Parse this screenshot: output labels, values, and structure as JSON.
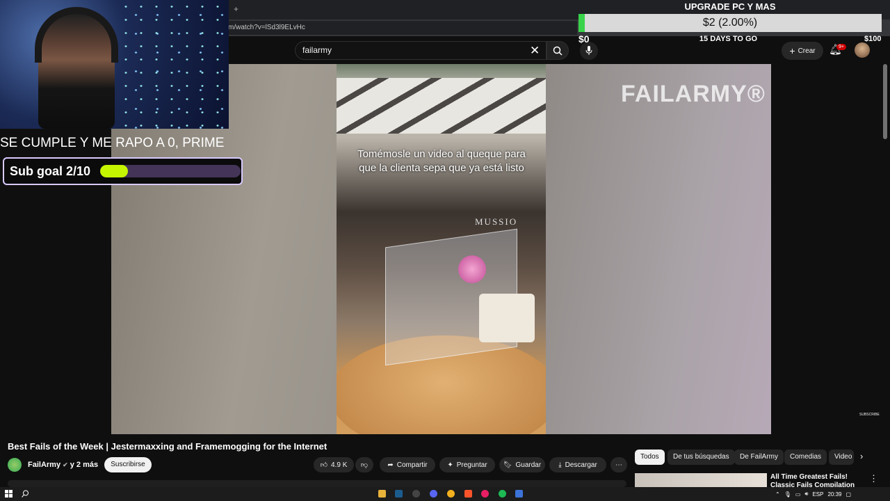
{
  "browser": {
    "tab_plus": "+",
    "address": "m/watch?v=lSd3l9ELvHc"
  },
  "youtube_header": {
    "search_value": "failarmy",
    "create_label": "Crear",
    "notifications_badge": "9+"
  },
  "overlay": {
    "marquee_text": "SE CUMPLE Y ME RAPO A 0, PRIME",
    "sub_goal_label": "Sub goal 2/10",
    "sub_goal_fraction": 0.2
  },
  "donation_goal": {
    "title": "UPGRADE PC Y MAS",
    "amount": "$2 (2.00%)",
    "progress_percent": 2.0,
    "min": "$0",
    "max": "$100",
    "days_left": "15 DAYS TO GO"
  },
  "video": {
    "caption": "Tomémosle un video al queque para que la clienta sepa que ya está listo",
    "watermark_brand": "FAILARMY®",
    "sign_text": "MUSSIO",
    "subscribe_watermark": "SUBSCRIBE"
  },
  "video_info": {
    "title": "Best Fails of the Week | Jestermaxxing and Framemogging for the Internet",
    "channel": "FailArmy",
    "channel_suffix": "y 2 más",
    "subscribe_label": "Suscribirse",
    "likes": "4.9 K",
    "share_label": "Compartir",
    "ask_label": "Preguntar",
    "save_label": "Guardar",
    "download_label": "Descargar"
  },
  "chips": [
    "Todos",
    "De tus búsquedas",
    "De FailArmy",
    "Comedias",
    "Video"
  ],
  "recommended": {
    "title": "All Time Greatest Fails! Classic Fails Compilation"
  },
  "taskbar": {
    "language": "ESP",
    "time": "20:39"
  },
  "colors": {
    "goal_fill": "#38d34a",
    "sub_goal_fill": "#c6f500",
    "notification_badge": "#cc0000"
  }
}
